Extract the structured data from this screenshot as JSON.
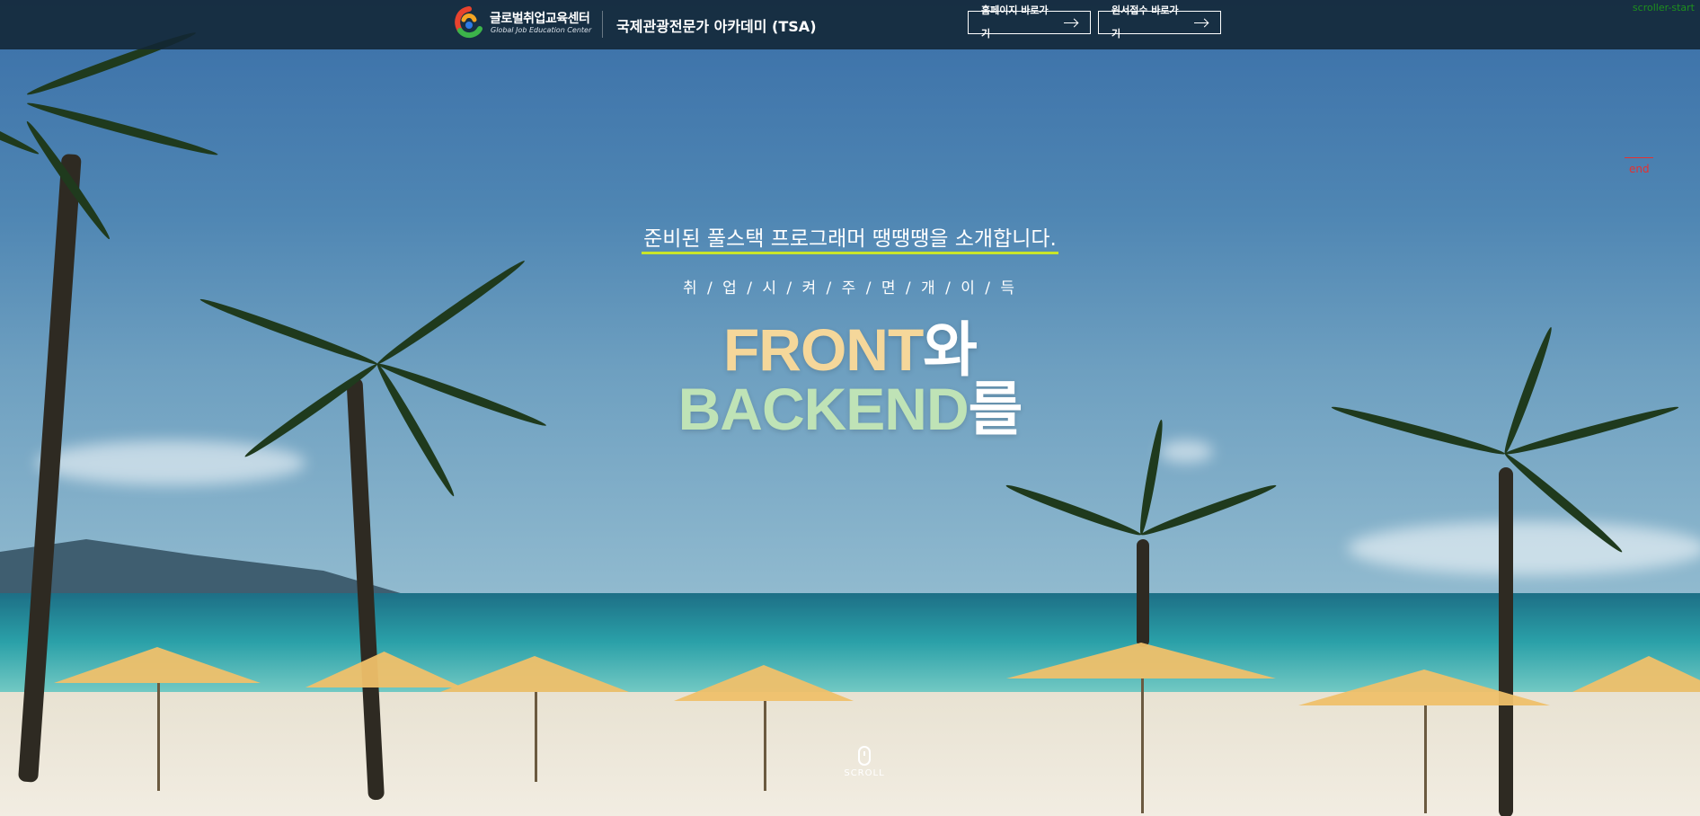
{
  "header": {
    "brand_ko": "글로벌취업교육센터",
    "brand_en": "Global Job Education Center",
    "academy": "국제관광전문가 아카데미 (TSA)",
    "buttons": [
      {
        "label": "홈페이지 바로가기",
        "icon": "arrow-right-icon"
      },
      {
        "label": "원서접수 바로가기",
        "icon": "arrow-right-icon"
      }
    ]
  },
  "debug": {
    "scroller_start": "scroller-start",
    "end": "end"
  },
  "hero": {
    "intro": "준비된 풀스택 프로그래머 땡땡땡을 소개합니다.",
    "job_words": "취 / 업 / 시 / 켜 / 주 / 면 / 개 / 이 / 득",
    "line1_a": "FRONT",
    "line1_b": "와",
    "line2_a": "BACKEND",
    "line2_b": "를"
  },
  "scroll": {
    "label": "SCROLL",
    "icon": "mouse-icon"
  },
  "colors": {
    "header_bg": "#122534",
    "underline": "#c9e52a",
    "front": "#f5d79a",
    "backend": "#bfe3b6",
    "debug_green": "#1e8f1e",
    "debug_red": "#e53030"
  }
}
